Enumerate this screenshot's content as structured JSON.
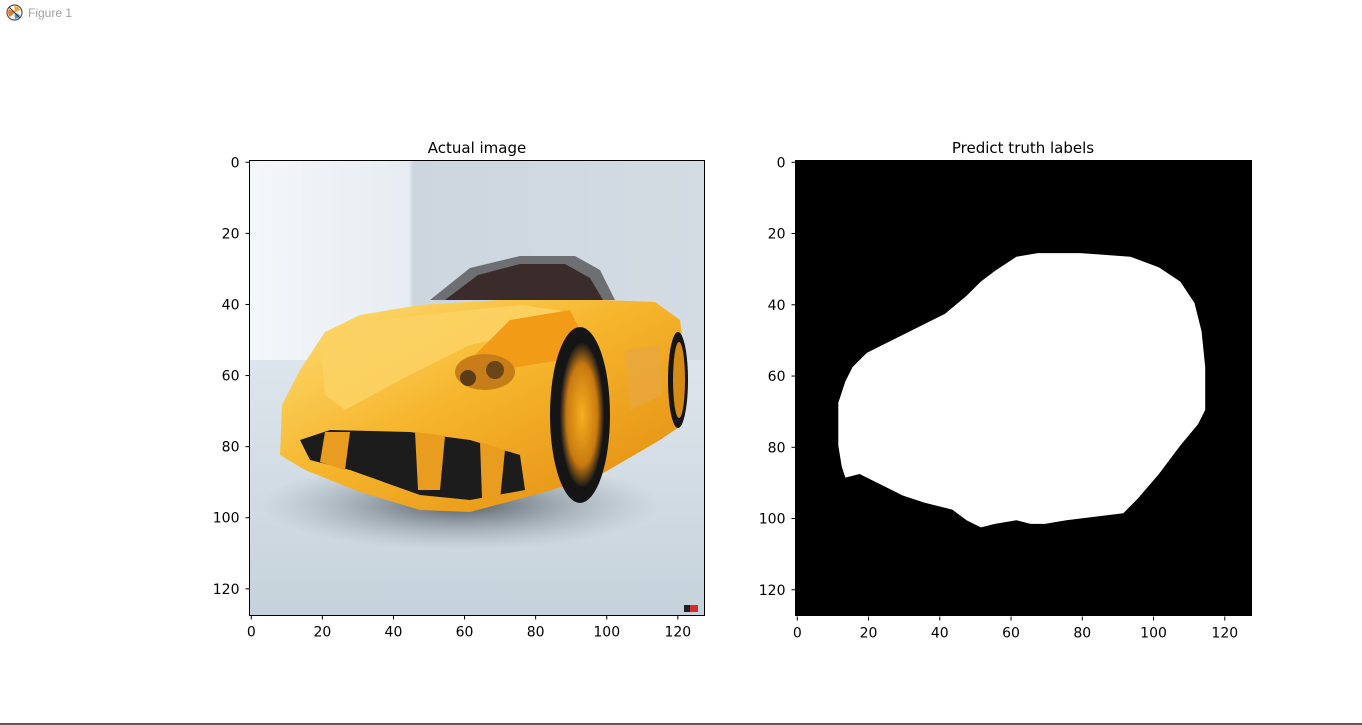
{
  "window": {
    "title": "Figure 1",
    "icon": "matplotlib-icon"
  },
  "colors": {
    "mask_background": "#000000",
    "mask_foreground": "#ffffff",
    "car_body": "#f5a81e",
    "wall": "#d2dbe3",
    "floor": "#c7d3dc"
  },
  "chart_data": [
    {
      "type": "image",
      "title": "Actual image",
      "xlim": [
        0,
        128
      ],
      "ylim": [
        128,
        0
      ],
      "xticks": [
        "0",
        "20",
        "40",
        "60",
        "80",
        "100",
        "120"
      ],
      "yticks": [
        "0",
        "20",
        "40",
        "60",
        "80",
        "100",
        "120"
      ],
      "content": "yellow sports car"
    },
    {
      "type": "image",
      "title": "Predict truth labels",
      "xlim": [
        0,
        128
      ],
      "ylim": [
        128,
        0
      ],
      "xticks": [
        "0",
        "20",
        "40",
        "60",
        "80",
        "100",
        "120"
      ],
      "yticks": [
        "0",
        "20",
        "40",
        "60",
        "80",
        "100",
        "120"
      ],
      "mask_outline": [
        [
          12,
          68
        ],
        [
          14,
          62
        ],
        [
          16,
          58
        ],
        [
          20,
          54
        ],
        [
          28,
          50
        ],
        [
          36,
          46
        ],
        [
          42,
          43
        ],
        [
          48,
          38
        ],
        [
          52,
          34
        ],
        [
          56,
          31
        ],
        [
          62,
          27
        ],
        [
          68,
          26
        ],
        [
          80,
          26
        ],
        [
          94,
          27
        ],
        [
          102,
          30
        ],
        [
          108,
          34
        ],
        [
          112,
          40
        ],
        [
          114,
          48
        ],
        [
          115,
          58
        ],
        [
          115,
          70
        ],
        [
          113,
          74
        ],
        [
          108,
          80
        ],
        [
          102,
          88
        ],
        [
          96,
          95
        ],
        [
          92,
          99
        ],
        [
          84,
          100
        ],
        [
          76,
          101
        ],
        [
          70,
          102
        ],
        [
          66,
          102
        ],
        [
          62,
          101
        ],
        [
          56,
          102
        ],
        [
          52,
          103
        ],
        [
          48,
          101
        ],
        [
          44,
          98
        ],
        [
          36,
          96
        ],
        [
          30,
          94
        ],
        [
          22,
          90
        ],
        [
          18,
          88
        ],
        [
          14,
          89
        ],
        [
          13,
          86
        ],
        [
          12,
          80
        ]
      ]
    }
  ]
}
